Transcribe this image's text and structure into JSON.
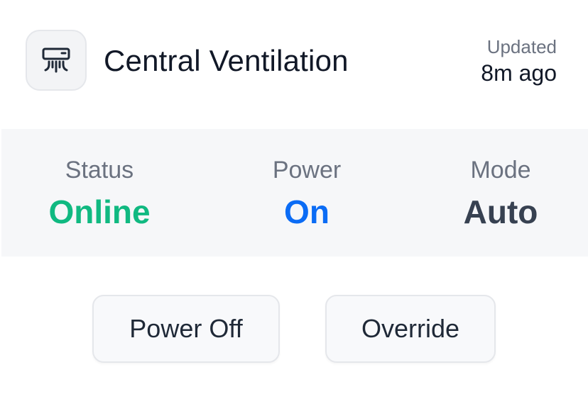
{
  "device": {
    "icon": "air-conditioner-icon",
    "title": "Central Ventilation"
  },
  "updated": {
    "label": "Updated",
    "value": "8m ago"
  },
  "stats": [
    {
      "label": "Status",
      "value": "Online",
      "color": "#10b981"
    },
    {
      "label": "Power",
      "value": "On",
      "color": "#0b6cf5"
    },
    {
      "label": "Mode",
      "value": "Auto",
      "color": "#374151"
    }
  ],
  "actions": {
    "power_off_label": "Power Off",
    "override_label": "Override"
  }
}
